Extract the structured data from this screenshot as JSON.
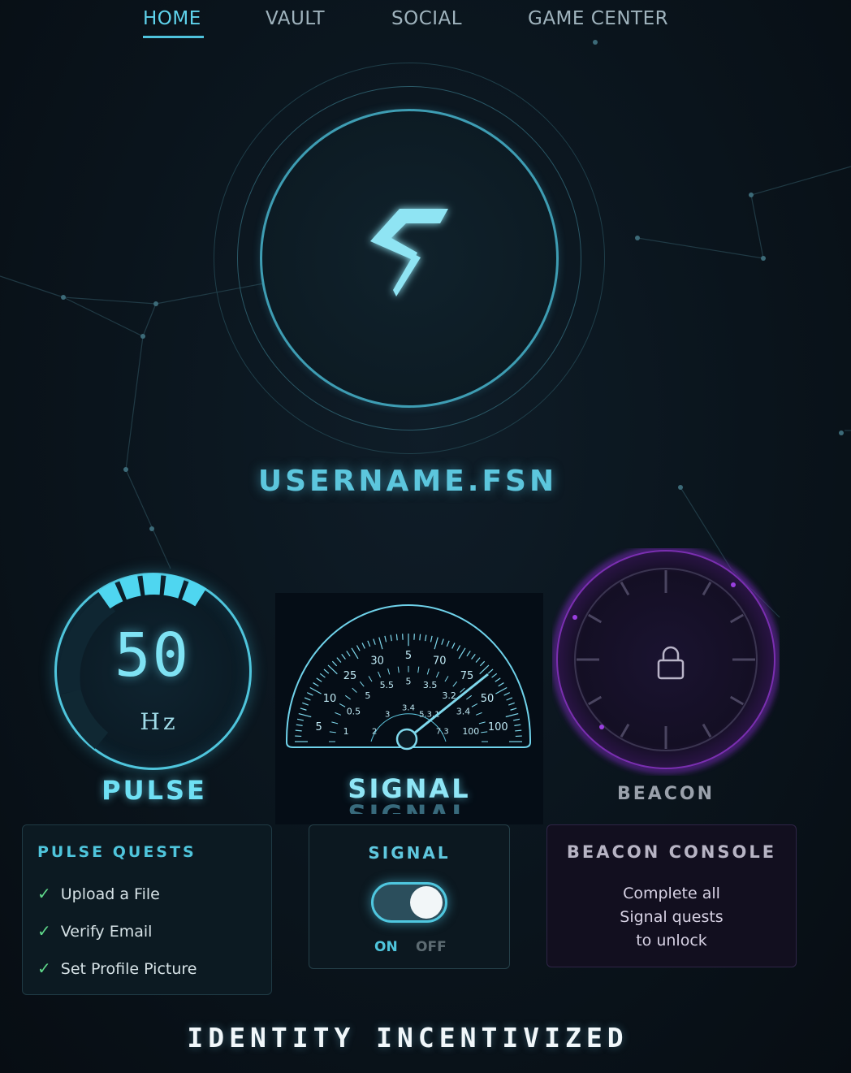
{
  "nav": {
    "items": [
      {
        "label": "HOME",
        "active": true
      },
      {
        "label": "VAULT",
        "active": false
      },
      {
        "label": "SOCIAL",
        "active": false
      },
      {
        "label": "GAME CENTER",
        "active": false
      }
    ]
  },
  "profile": {
    "username": "USERNAME.FSN",
    "logo_icon": "fsn-lightning-logo"
  },
  "pulse": {
    "value": "50",
    "unit": "Hz",
    "label": "PULSE",
    "level": 0.4
  },
  "signal": {
    "label": "SIGNAL",
    "label_shadow": "SIGNAL",
    "scale_outer": [
      "5",
      "10",
      "25",
      "30",
      "5",
      "70",
      "75",
      "50",
      "100"
    ],
    "scale_mid": [
      "1",
      "0.5",
      "5",
      "5.5",
      "5",
      "3.5",
      "3.2",
      "3.4",
      "100"
    ],
    "scale_inner": [
      "2",
      "3",
      "3.4",
      "5.3.1",
      "7.3"
    ]
  },
  "beacon": {
    "label": "BEACON",
    "locked": true,
    "icon": "lock-icon"
  },
  "quests": {
    "title": "PULSE QUESTS",
    "items": [
      "Upload a File",
      "Verify Email",
      "Set Profile Picture"
    ]
  },
  "signal_panel": {
    "title": "SIGNAL",
    "on_label": "ON",
    "off_label": "OFF",
    "state": "on"
  },
  "console": {
    "title": "BEACON CONSOLE",
    "lines": [
      "Complete all",
      "Signal quests",
      "to unlock"
    ]
  },
  "footer": {
    "tagline": "IDENTITY INCENTIVIZED"
  },
  "colors": {
    "accent": "#4fc5dc",
    "beacon": "#7a2fb0",
    "check": "#5fd88a"
  }
}
